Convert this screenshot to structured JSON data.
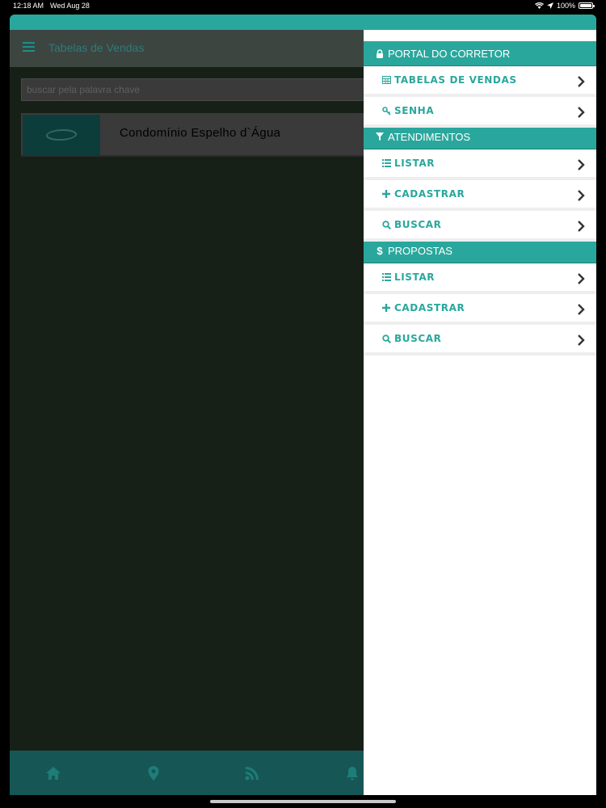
{
  "status_bar": {
    "time": "12:18 AM",
    "date": "Wed Aug 28",
    "battery": "100%"
  },
  "header": {
    "title": "Tabelas de Vendas"
  },
  "search": {
    "placeholder": "buscar pela palavra chave"
  },
  "card": {
    "title": "Condomínio Espelho d`Água"
  },
  "bottom_nav": [
    "home-icon",
    "location-pin-icon",
    "rss-icon",
    "bell-icon"
  ],
  "drawer": {
    "sections": [
      {
        "title": "PORTAL DO CORRETOR",
        "icon": "lock-icon",
        "items": [
          {
            "label": "TABELAS DE VENDAS",
            "icon": "table-icon"
          },
          {
            "label": "SENHA",
            "icon": "key-icon"
          }
        ]
      },
      {
        "title": "ATENDIMENTOS",
        "icon": "filter-icon",
        "items": [
          {
            "label": "LISTAR",
            "icon": "list-icon"
          },
          {
            "label": "CADASTRAR",
            "icon": "plus-icon"
          },
          {
            "label": "BUSCAR",
            "icon": "search-icon"
          }
        ]
      },
      {
        "title": "PROPOSTAS",
        "icon": "dollar-icon",
        "items": [
          {
            "label": "LISTAR",
            "icon": "list-icon"
          },
          {
            "label": "CADASTRAR",
            "icon": "plus-icon"
          },
          {
            "label": "BUSCAR",
            "icon": "search-icon"
          }
        ]
      }
    ]
  },
  "colors": {
    "accent": "#2aa79d",
    "drawer_bg": "#ffffff",
    "overlay": "#172017"
  }
}
